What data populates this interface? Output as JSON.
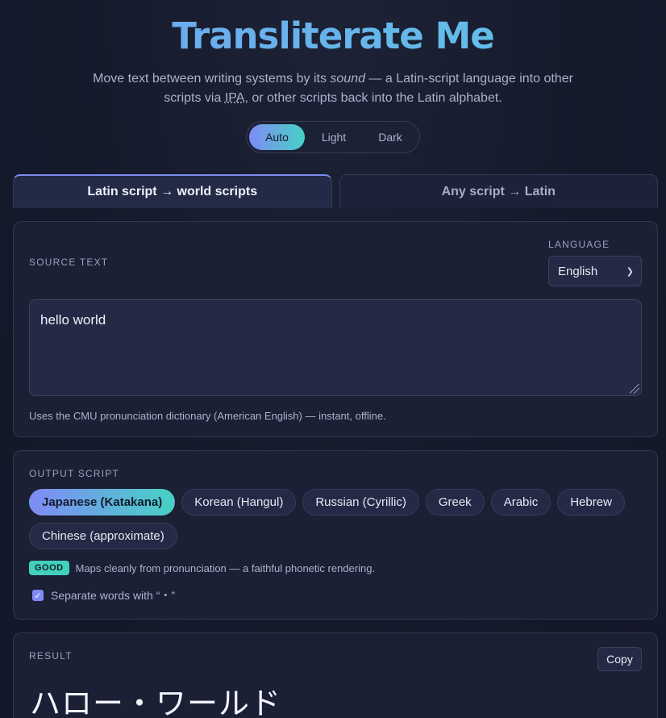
{
  "header": {
    "title": "Transliterate Me",
    "subtitle_part1": "Move text between writing systems by its ",
    "subtitle_em": "sound",
    "subtitle_part2": " — a Latin-script language into other scripts via ",
    "subtitle_ipa": "IPA",
    "subtitle_part3": ", or other scripts back into the Latin alphabet."
  },
  "theme": {
    "options": [
      "Auto",
      "Light",
      "Dark"
    ],
    "selected": "Auto"
  },
  "tabs": [
    {
      "label": "Latin script → world scripts",
      "active": true
    },
    {
      "label": "Any script → Latin",
      "active": false
    }
  ],
  "source": {
    "label": "SOURCE TEXT",
    "language_label": "LANGUAGE",
    "language_value": "English",
    "text": "hello world",
    "hint": "Uses the CMU pronunciation dictionary (American English) — instant, offline."
  },
  "output": {
    "label": "OUTPUT SCRIPT",
    "scripts": [
      "Japanese (Katakana)",
      "Korean (Hangul)",
      "Russian (Cyrillic)",
      "Greek",
      "Arabic",
      "Hebrew",
      "Chinese (approximate)"
    ],
    "selected": "Japanese (Katakana)",
    "quality_badge": "GOOD",
    "quality_text": "Maps cleanly from pronunciation — a faithful phonetic rendering.",
    "separate_label": "Separate words with “・”",
    "separate_checked": true
  },
  "result": {
    "label": "RESULT",
    "copy_label": "Copy",
    "text": "ハロー・ワールド"
  },
  "colors": {
    "accent_start": "#7f8bf5",
    "accent_end": "#47d1c5",
    "title_gradient": "#6fa3f0",
    "background": "#151a2b",
    "badge_good": "#42d0bd"
  }
}
